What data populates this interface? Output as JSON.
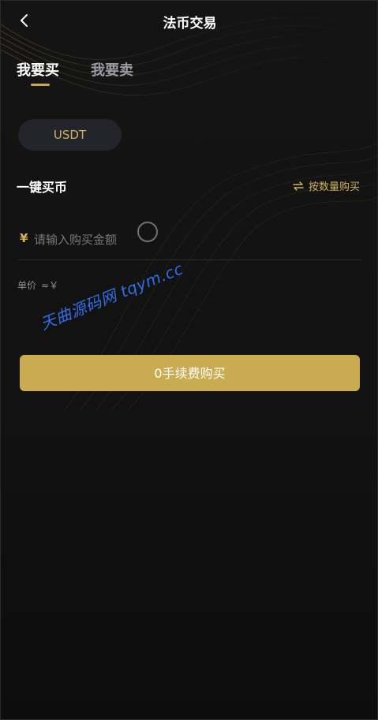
{
  "nav": {
    "title": "法币交易",
    "back_icon": "chevron-left-icon"
  },
  "tabs": {
    "buy": "我要买",
    "sell": "我要卖",
    "active": "buy"
  },
  "coin": {
    "selected": "USDT"
  },
  "quick_buy": {
    "title": "一键买币",
    "switch_label": "按数量购买",
    "switch_icon": "swap-arrows-icon"
  },
  "amount": {
    "currency_symbol": "¥",
    "placeholder": "请输入购买金额",
    "value": ""
  },
  "unit_price": {
    "label": "单价",
    "value": "≈￥"
  },
  "action": {
    "buy_label": "0手续费购买"
  },
  "watermark": {
    "text": "天曲源码网 tqym.cc"
  },
  "colors": {
    "accent": "#c9ab50",
    "background": "#121212",
    "watermark": "#2f6ee8"
  }
}
